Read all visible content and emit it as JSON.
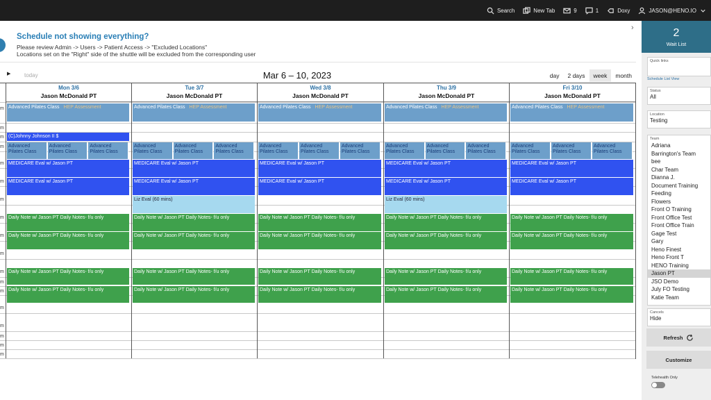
{
  "topbar": {
    "search_label": "Search",
    "newtab_label": "New Tab",
    "mail_count": "9",
    "messages_count": "1",
    "doxy_label": "Doxy",
    "user_label": "JASON@HENO.IO"
  },
  "banner": {
    "title": "Schedule not showing everything?",
    "line1": "Please review Admin -> Users -> Patient Access -> \"Excluded Locations\"",
    "line2": "Locations set on the \"Right\" side of the shuttle will be excluded from the corresponding user"
  },
  "calendar": {
    "today_label": "today",
    "date_range": "Mar 6 – 10, 2023",
    "views": [
      "day",
      "2 days",
      "week",
      "month"
    ],
    "active_view": "week",
    "time_label_fragment": "m",
    "days": [
      {
        "date": "Mon 3/6",
        "provider": "Jason McDonald PT"
      },
      {
        "date": "Tue 3/7",
        "provider": "Jason McDonald PT"
      },
      {
        "date": "Wed 3/8",
        "provider": "Jason McDonald PT"
      },
      {
        "date": "Thu 3/9",
        "provider": "Jason McDonald PT"
      },
      {
        "date": "Fri 3/10",
        "provider": "Jason McDonald PT"
      }
    ],
    "events": {
      "pilates_class": "Advanced Pilates Class",
      "faded_label": "HEP Assessment",
      "pilates_split": "Advanced Pilates Class",
      "johnny": "(C)Johnny Johnson II $",
      "medicare": "MEDICARE Eval w/ Jason PT",
      "liz": "Liz Eval (60 mins)",
      "daily_note": "Daily Note w/ Jason PT Daily Notes- f/u only"
    }
  },
  "rightpanel": {
    "waitlist_count": "2",
    "waitlist_label": "Wait List",
    "quicklinks_caption": "Quick links",
    "schedule_link": "Schedule List View",
    "status_caption": "Status",
    "status_value": "All",
    "location_caption": "Location",
    "location_value": "Testing",
    "team_caption": "Team",
    "teams": [
      "Adriana",
      "Barrington's Team",
      "bee",
      "Char Team",
      "Dianna J.",
      "Document Training",
      "Feeding",
      "Flowers",
      "Front O Training",
      "Front Office Test",
      "Front Office Train",
      "Gage Test",
      "Gary",
      "Heno Finest",
      "Heno Front T",
      "HENO Training",
      "Jason PT",
      "JSO Demo",
      "July FO Testing",
      "Katie Team"
    ],
    "selected_team": "Jason PT",
    "cancels_caption": "Cancels",
    "cancels_value": "Hide",
    "refresh_label": "Refresh",
    "customize_label": "Customize",
    "telehealth_label": "Telehealth Only"
  }
}
